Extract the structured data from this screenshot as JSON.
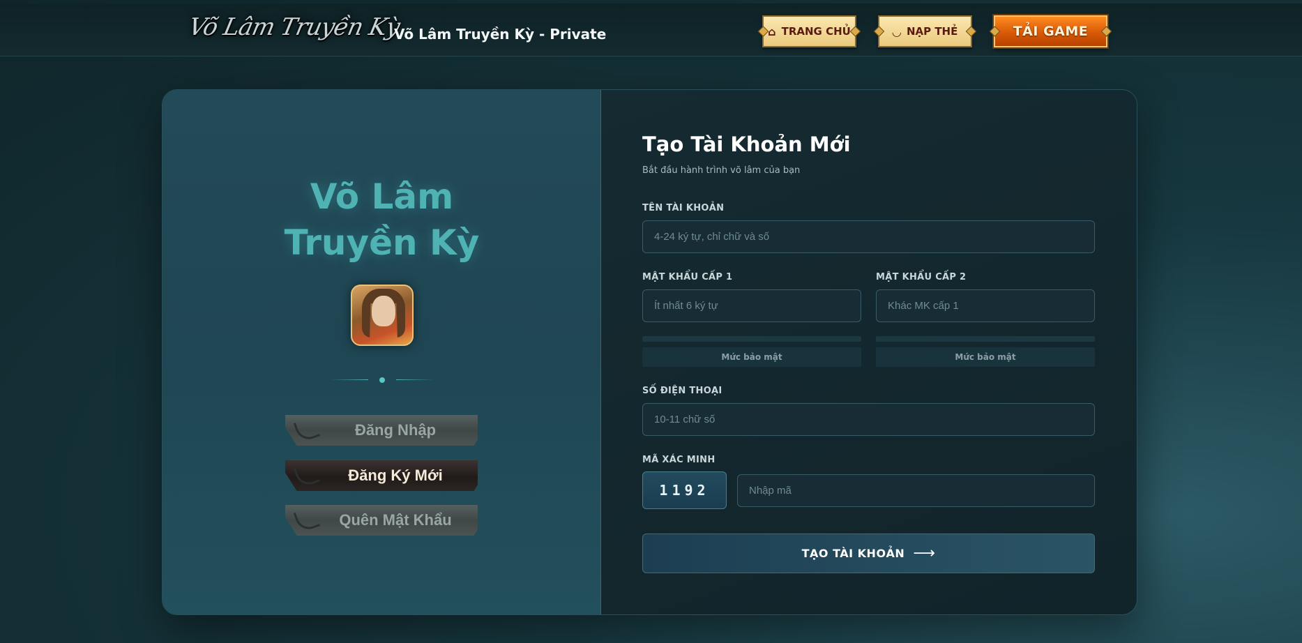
{
  "header": {
    "logo_text": "Võ Lâm Truyền Kỳ",
    "site_title": "Võ Lâm Truyền Kỳ - Private",
    "nav": {
      "home": {
        "label": "TRANG CHỦ",
        "icon": "home-icon"
      },
      "topup": {
        "label": "NẠP THẺ",
        "icon": "ingot-icon"
      },
      "download": {
        "label": "TẢI GAME"
      }
    }
  },
  "side": {
    "title_line1": "Võ Lâm",
    "title_line2": "Truyền Kỳ",
    "buttons": {
      "login": "Đăng Nhập",
      "register": "Đăng Ký Mới",
      "forgot": "Quên Mật Khẩu"
    },
    "active": "register"
  },
  "form": {
    "title": "Tạo Tài Khoản Mới",
    "subtitle": "Bắt đầu hành trình võ lâm của bạn",
    "username": {
      "label": "TÊN TÀI KHOẢN",
      "placeholder": "4-24 ký tự, chỉ chữ và số"
    },
    "password1": {
      "label": "MẬT KHẨU CẤP 1",
      "placeholder": "Ít nhất 6 ký tự",
      "strength_label": "Mức bảo mật"
    },
    "password2": {
      "label": "MẬT KHẨU CẤP 2",
      "placeholder": "Khác MK cấp 1",
      "strength_label": "Mức bảo mật"
    },
    "phone": {
      "label": "SỐ ĐIỆN THOẠI",
      "placeholder": "10-11 chữ số"
    },
    "captcha": {
      "label": "MÃ XÁC MINH",
      "code": "1192",
      "placeholder": "Nhập mã"
    },
    "submit_label": "TẠO TÀI KHOẢN",
    "submit_arrow": "⟶"
  },
  "colors": {
    "accent_teal": "#4fb3b4",
    "download_orange": "#e86a10",
    "nav_gold": "#eac97d"
  }
}
